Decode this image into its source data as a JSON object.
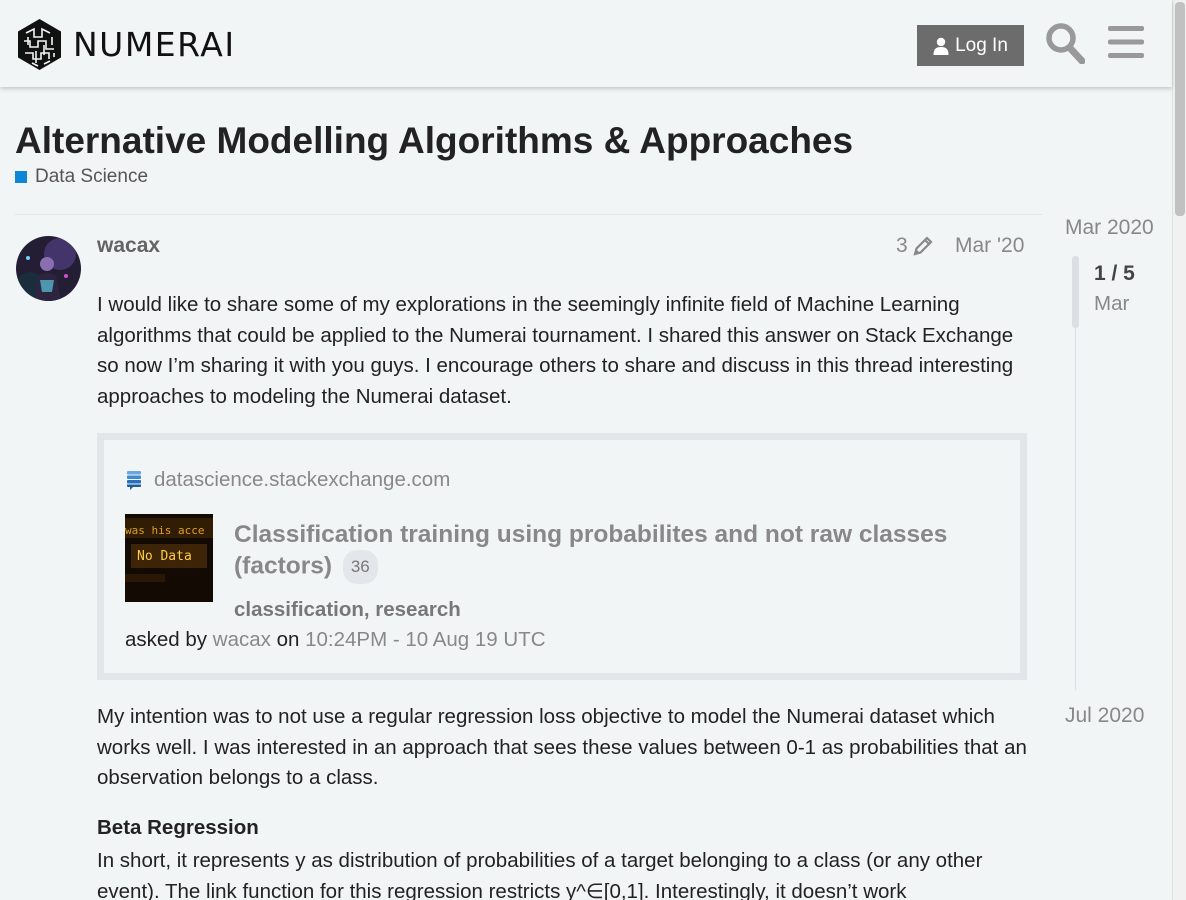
{
  "header": {
    "logo_text": "NUMERAI",
    "login_label": "Log In",
    "search_icon": "search-icon",
    "menu_icon": "hamburger-menu-icon"
  },
  "topic": {
    "title": "Alternative Modelling Algorithms & Approaches",
    "category": "Data Science",
    "category_color": "#0e87d6"
  },
  "post": {
    "username": "wacax",
    "edit_count": "3",
    "date": "Mar '20",
    "paragraph1": "I would like to share some of my explorations in the seemingly infinite field of Machine Learning algorithms that could be applied to the Numerai tournament. I shared this answer on Stack Exchange so now I’m sharing it with you guys. I encourage others to share and discuss in this thread interesting approaches to modeling the Numerai dataset.",
    "onebox": {
      "source": "datascience.stackexchange.com",
      "thumb_text_1": "was his acce",
      "thumb_text_2": "No Data",
      "title": "Classification training using probabilites and not raw classes (factors)",
      "count": "36",
      "tags": "classification, research",
      "asked_by_label": "asked by",
      "asked_by_user": "wacax",
      "on_label": "on",
      "asked_time": "10:24PM - 10 Aug 19 UTC"
    },
    "paragraph2": "My intention was to not use a regular regression loss objective to model the Numerai dataset which works well. I was interested in an approach that sees these values between 0-1 as probabilities that an observation belongs to a class.",
    "beta_heading": "Beta Regression",
    "paragraph3": "In short, it represents y as distribution of probabilities of a target belonging to a class (or any other event). The link function for this regression restricts y^∈[0,1]. Interestingly, it doesn’t work"
  },
  "timeline": {
    "start": "Mar 2020",
    "position": "1 / 5",
    "month": "Mar",
    "end": "Jul 2020"
  }
}
